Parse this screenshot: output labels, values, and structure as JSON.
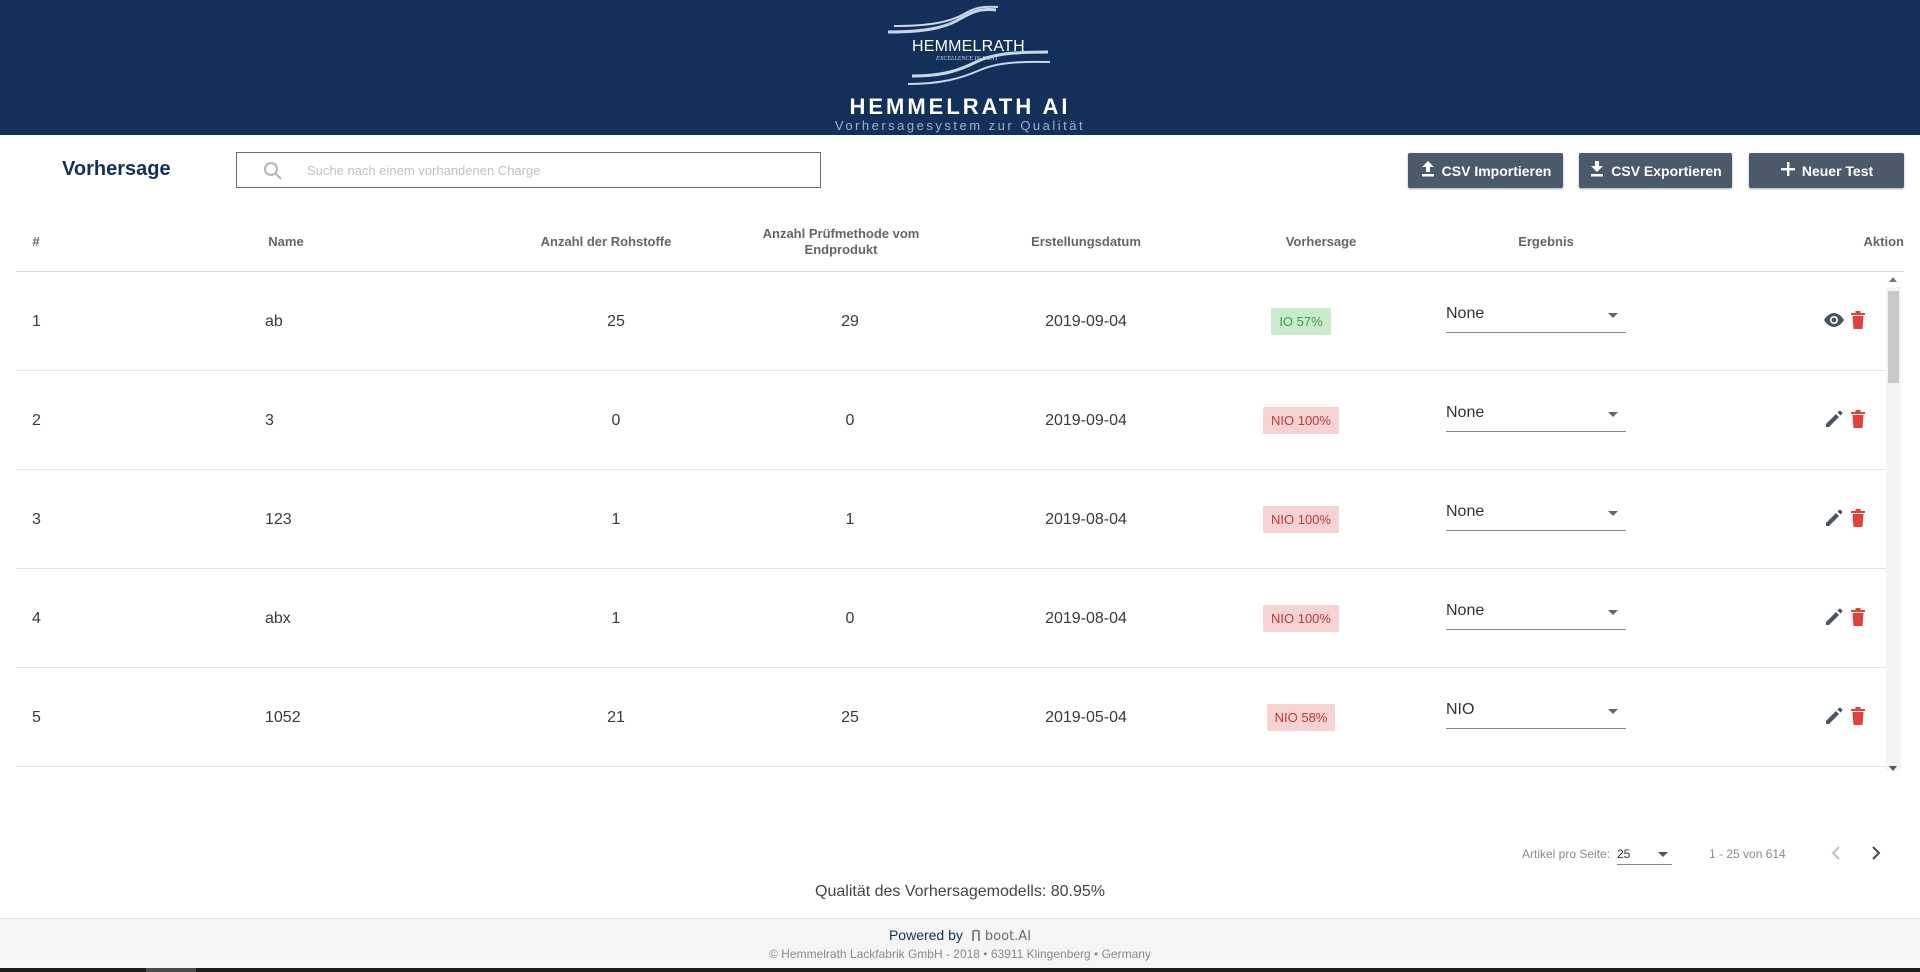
{
  "header": {
    "logo_word": "HEMMELRATH",
    "logo_tagline": "EXCELLENCE IN PAINT",
    "title": "HEMMELRATH AI",
    "subtitle": "Vorhersagesystem zur Qualität",
    "background": "#12305a"
  },
  "toolbar": {
    "page_title": "Vorhersage",
    "search_placeholder": "Suche nach einem vorhandenen Charge",
    "search_icon": "search-icon",
    "import_label": "CSV Importieren",
    "export_label": "CSV Exportieren",
    "new_label": "Neuer Test"
  },
  "table": {
    "headers": {
      "num": "#",
      "name": "Name",
      "raw": "Anzahl der Rohstoffe",
      "test": "Anzahl Prüfmethode vom Endprodukt",
      "date": "Erstellungsdatum",
      "prediction": "Vorhersage",
      "result": "Ergebnis",
      "action": "Aktion"
    },
    "rows": [
      {
        "num": "1",
        "name": "ab",
        "raw": "25",
        "test": "29",
        "date": "2019-09-04",
        "prediction": "IO 57%",
        "status": "ok",
        "result": "None",
        "first_action": "view"
      },
      {
        "num": "2",
        "name": "3",
        "raw": "0",
        "test": "0",
        "date": "2019-09-04",
        "prediction": "NIO 100%",
        "status": "nio",
        "result": "None",
        "first_action": "edit"
      },
      {
        "num": "3",
        "name": "123",
        "raw": "1",
        "test": "1",
        "date": "2019-08-04",
        "prediction": "NIO 100%",
        "status": "nio",
        "result": "None",
        "first_action": "edit"
      },
      {
        "num": "4",
        "name": "abx",
        "raw": "1",
        "test": "0",
        "date": "2019-08-04",
        "prediction": "NIO 100%",
        "status": "nio",
        "result": "None",
        "first_action": "edit"
      },
      {
        "num": "5",
        "name": "1052",
        "raw": "21",
        "test": "25",
        "date": "2019-05-04",
        "prediction": "NIO 58%",
        "status": "nio",
        "result": "NIO",
        "first_action": "edit"
      }
    ],
    "colors": {
      "io_bg": "#c9ebcc",
      "io_text": "#3f9a4a",
      "nio_bg": "#f6d2d2",
      "nio_text": "#c0393b",
      "delete": "#e2403a"
    }
  },
  "pagination": {
    "per_page_label": "Artikel pro Seite:",
    "per_page_value": "25",
    "range": "1 - 25 von 614"
  },
  "quality": "Qualität des Vorhersagemodells: 80.95%",
  "footer": {
    "powered_by": "Powered by",
    "brand": "boot.AI",
    "copyright": "© Hemmelrath Lackfabrik GmbH - 2018 • 63911 Klingenberg • Germany"
  }
}
